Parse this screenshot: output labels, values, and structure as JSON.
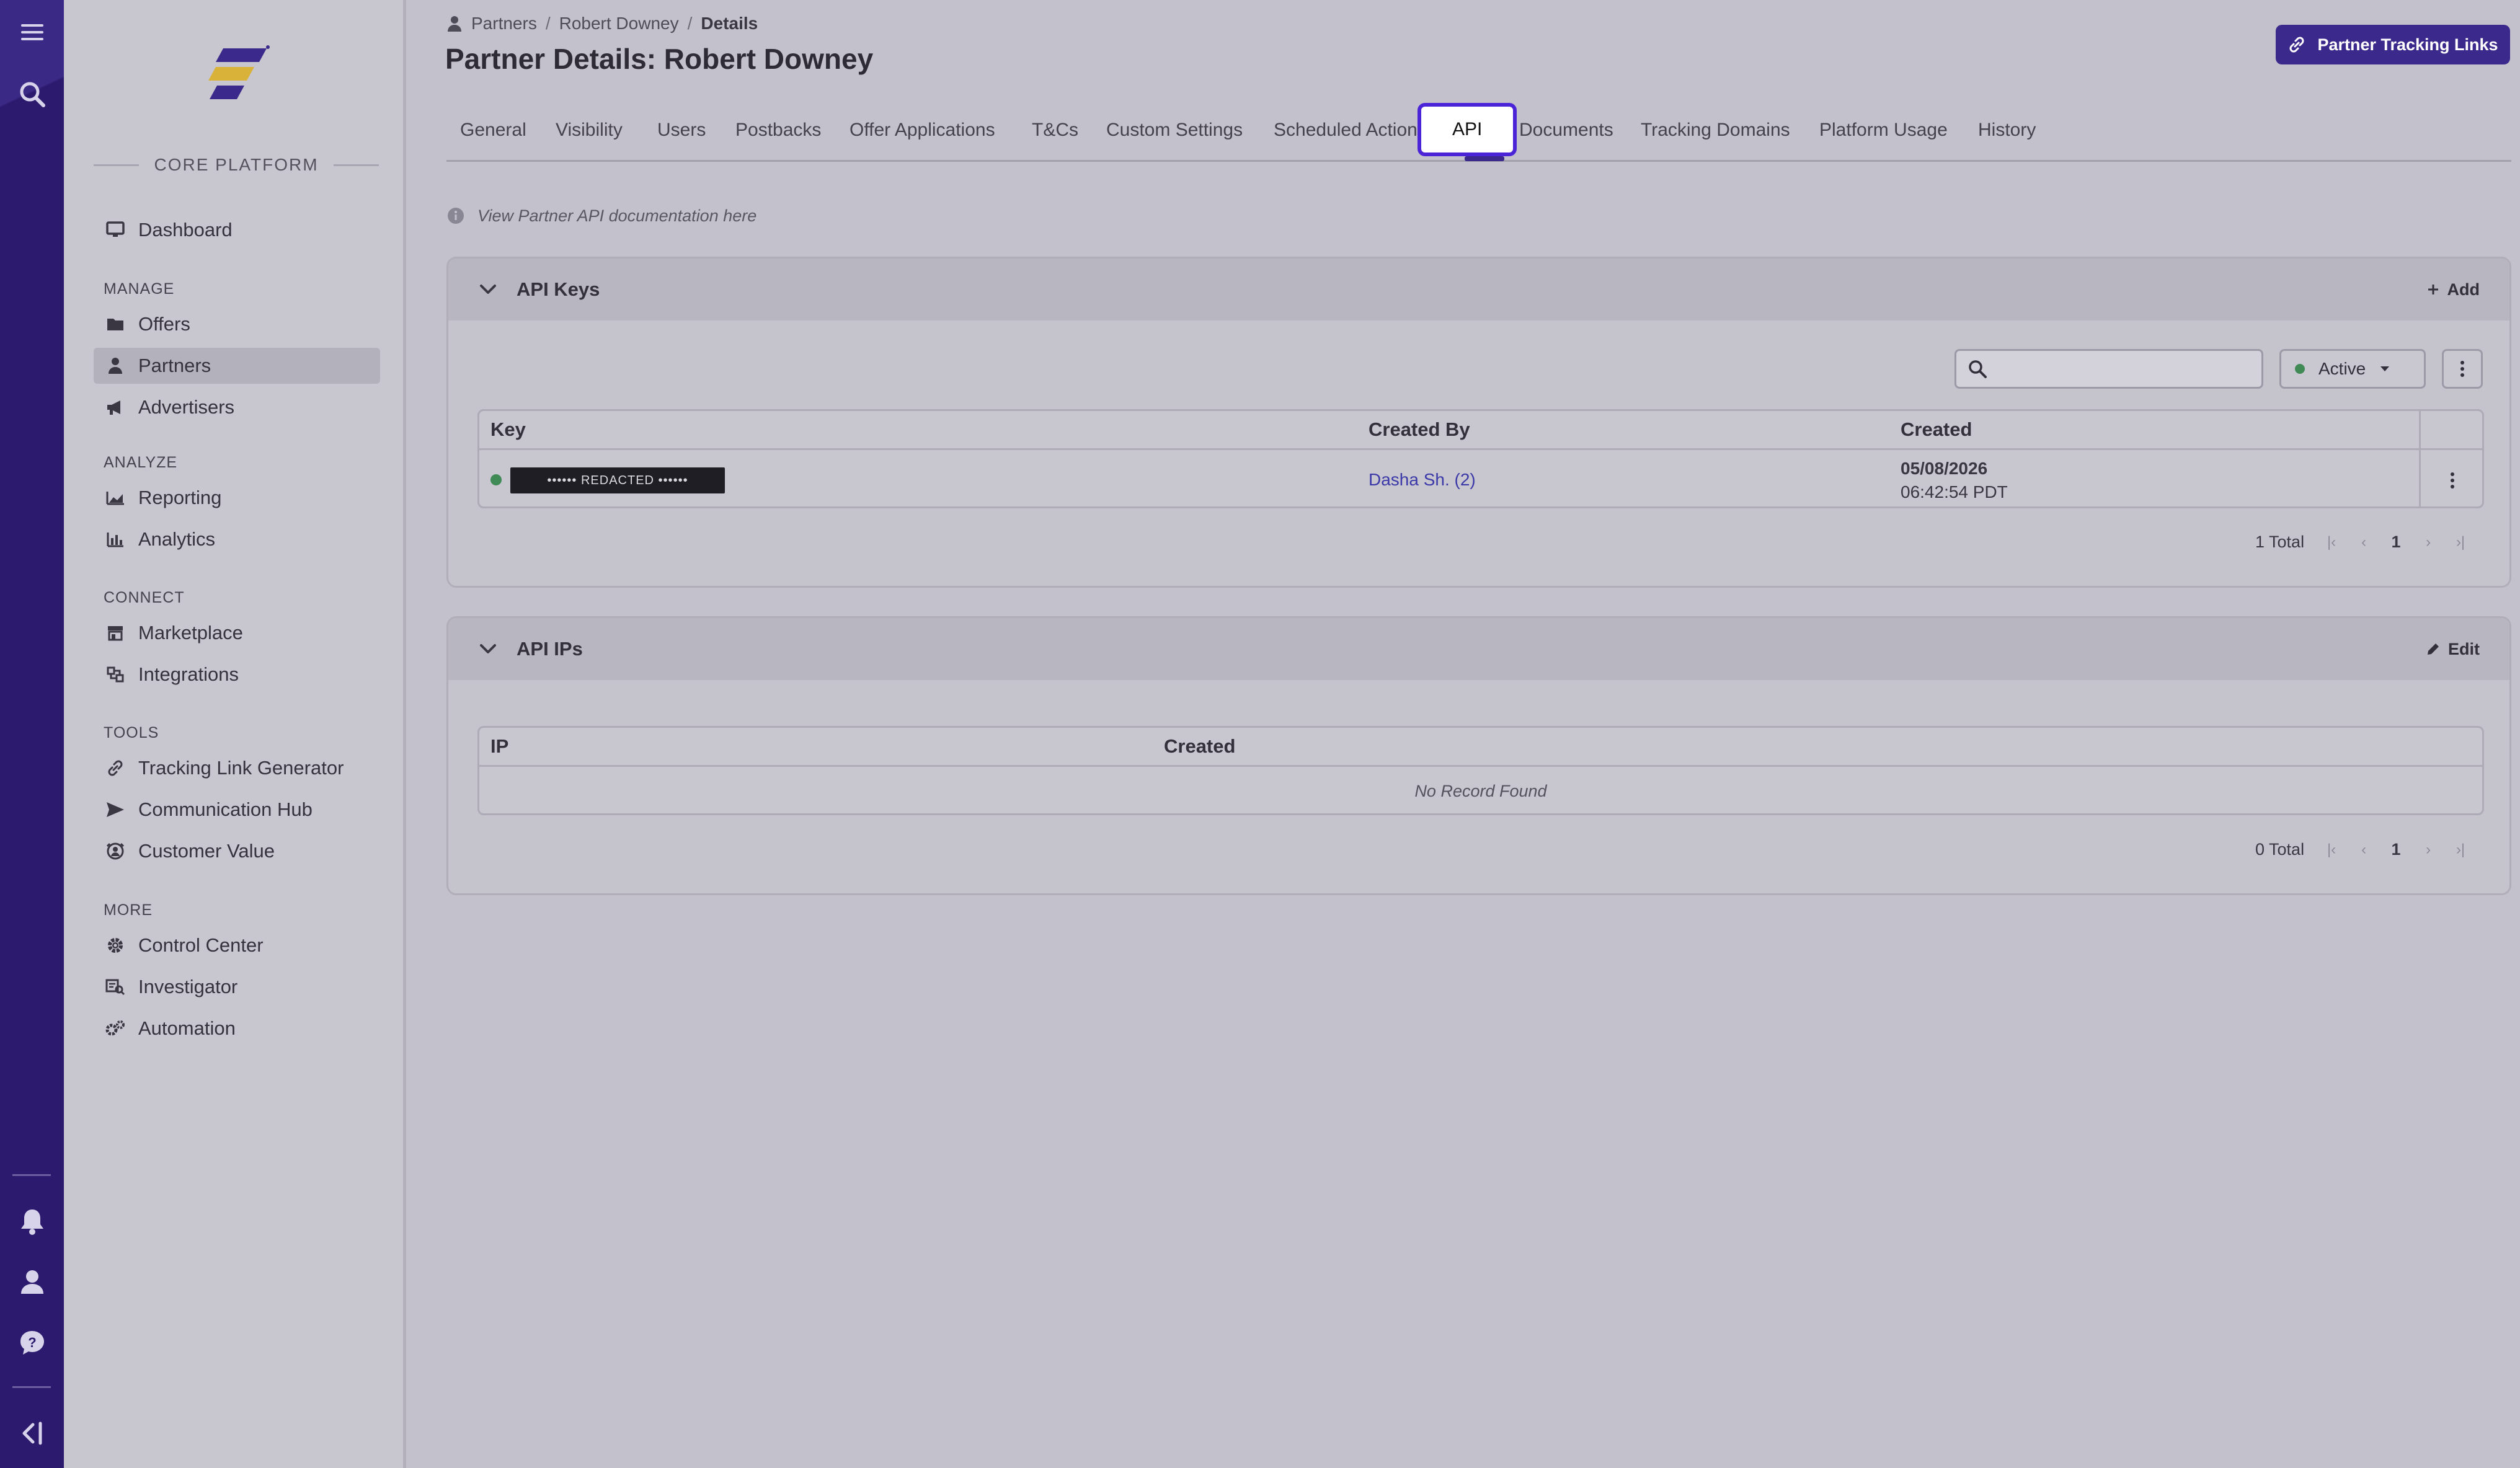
{
  "sidebar": {
    "section_header": "CORE PLATFORM",
    "dashboard": "Dashboard",
    "manage_title": "MANAGE",
    "offers": "Offers",
    "partners": "Partners",
    "advertisers": "Advertisers",
    "analyze_title": "ANALYZE",
    "reporting": "Reporting",
    "analytics": "Analytics",
    "connect_title": "CONNECT",
    "marketplace": "Marketplace",
    "integrations": "Integrations",
    "tools_title": "TOOLS",
    "tracking_link_generator": "Tracking Link Generator",
    "communication_hub": "Communication Hub",
    "customer_value": "Customer Value",
    "more_title": "MORE",
    "control_center": "Control Center",
    "investigator": "Investigator",
    "automation": "Automation"
  },
  "breadcrumb": {
    "partners": "Partners",
    "partner_name": "Robert Downey",
    "current": "Details",
    "separator": "/"
  },
  "page": {
    "title": "Partner Details: Robert Downey",
    "tracking_links_button": "Partner Tracking Links",
    "doc_note": "View Partner API documentation here"
  },
  "tabs": {
    "general": "General",
    "visibility": "Visibility",
    "users": "Users",
    "postbacks": "Postbacks",
    "offer_applications": "Offer Applications",
    "tcs": "T&Cs",
    "custom_settings": "Custom Settings",
    "scheduled_actions": "Scheduled Actions",
    "api": "API",
    "documents": "Documents",
    "tracking_domains": "Tracking Domains",
    "platform_usage": "Platform Usage",
    "history": "History"
  },
  "api_keys": {
    "title": "API Keys",
    "add_label": "Add",
    "search_placeholder": "",
    "status_filter": "Active",
    "columns": {
      "key": "Key",
      "created_by": "Created By",
      "created": "Created"
    },
    "rows": [
      {
        "key": "•••••• REDACTED ••••••",
        "created_by": "Dasha Sh. (2)",
        "created_date": "05/08/2026",
        "created_time": "06:42:54 PDT"
      }
    ],
    "total": "1 Total",
    "page": "1"
  },
  "api_ips": {
    "title": "API IPs",
    "edit_label": "Edit",
    "columns": {
      "ip": "IP",
      "created": "Created"
    },
    "empty": "No Record Found",
    "total": "0 Total",
    "page": "1"
  },
  "colors": {
    "rail": "#2c1a6e",
    "accent": "#3b2a8c",
    "active_tab_border": "#4a24d6",
    "status_active": "#3f8a55"
  },
  "icons": {
    "menu": "hamburger-icon",
    "search": "search-icon",
    "notifications": "bell-icon",
    "profile": "user-icon",
    "help": "help-icon",
    "collapse": "collapse-sidebar-icon"
  }
}
